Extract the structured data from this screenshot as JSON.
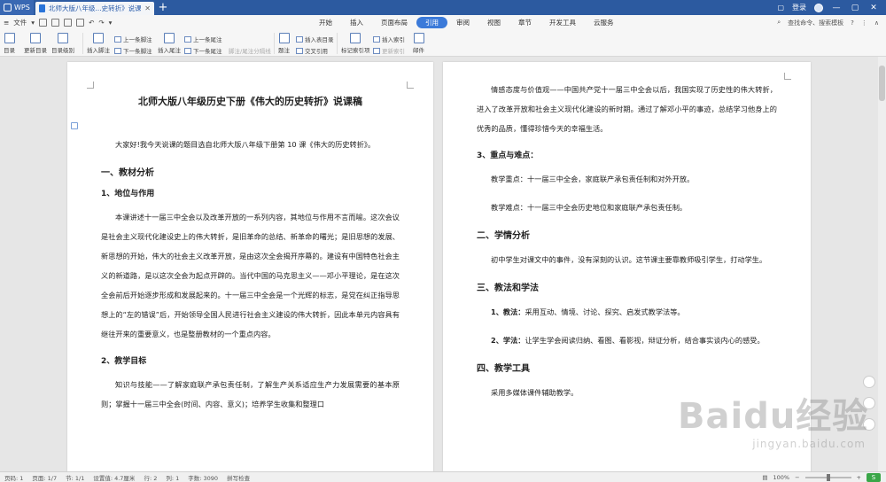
{
  "titlebar": {
    "app_tab": "WPS",
    "doc_tab": "北师大版八年级...史转折》说课稿",
    "login": "登录"
  },
  "menubar": {
    "file": "文件",
    "tabs": [
      "开始",
      "插入",
      "页面布局",
      "引用",
      "审阅",
      "视图",
      "章节",
      "开发工具",
      "云服务"
    ],
    "active_tab": "引用",
    "search": "查找命令、搜索模板"
  },
  "ribbon": {
    "toc": "目录",
    "update_toc": "更新目录",
    "toc_level": "目录级别",
    "insert_footnote": "插入脚注",
    "prev_footnote": "上一条脚注",
    "next_footnote": "下一条脚注",
    "insert_endnote": "插入尾注",
    "prev_endnote": "上一条尾注",
    "next_endnote": "下一条尾注",
    "note_separator": "脚注/尾注分隔线",
    "caption": "题注",
    "insert_table_of_figures": "插入表目录",
    "cross_reference": "交叉引用",
    "mark_index": "标记索引项",
    "insert_index": "插入索引",
    "update_index": "更新索引",
    "mail": "邮件"
  },
  "left_page": {
    "title": "北师大版八年级历史下册《伟大的历史转折》说课稿",
    "intro": "大家好!我今天说课的题目选自北师大版八年级下册第 10 课《伟大的历史转折》。",
    "h1_1": "一、教材分析",
    "h2_1": "1、地位与作用",
    "para_1": "本课讲述十一届三中全会以及改革开放的一系列内容，其地位与作用不言而喻。这次会议是社会主义现代化建设史上的伟大转折，是旧革命的总结、新革命的曙光；是旧思想的发展、新思想的开始，伟大的社会主义改革开放，是由这次全会揭开序幕的。建设有中国特色社会主义的新道路，是以这次全会为起点开辟的。当代中国的马克思主义——邓小平理论，是在这次全会前后开始逐步形成和发展起来的。十一届三中全会是一个光辉的标志，是党在纠正指导思想上的“左的错误”后，开始领导全国人民进行社会主义建设的伟大转折，因此本单元内容具有继往开来的重要意义，也是整册教材的一个重点内容。",
    "h2_2": "2、教学目标",
    "para_2": "知识与技能——了解家庭联产承包责任制，了解生产关系适应生产力发展需要的基本原则；掌握十一届三中全会(时间、内容、意义)；培养学生收集和整理口"
  },
  "right_page": {
    "para_1": "情感态度与价值观——中国共产党十一届三中全会以后，我国实现了历史性的伟大转折，进入了改革开放和社会主义现代化建设的新时期。通过了解邓小平的事迹，总结学习他身上的优秀的品质，懂得珍惜今天的幸福生活。",
    "h2_3": "3、重点与难点：",
    "key_point": "教学重点：十一届三中全会，家庭联产承包责任制和对外开放。",
    "difficult_point": "教学难点：十一届三中全会历史地位和家庭联产承包责任制。",
    "h1_2": "二、学情分析",
    "para_2": "初中学生对课文中的事件，没有深刻的认识。这节课主要靠教师吸引学生，打动学生。",
    "h1_3": "三、教法和学法",
    "teach_label": "1、教法：",
    "teach_text": "采用互动、情境、讨论、探究、启发式教学法等。",
    "learn_label": "2、学法：",
    "learn_text": "让学生学会阅读归纳、看图、看影视，辩证分析，结合事实谈内心的感受。",
    "h1_4": "四、教学工具",
    "tools": "采用多媒体课件辅助教学。"
  },
  "statusbar": {
    "page": "页码: 1",
    "pages": "页面: 1/7",
    "section": "节: 1/1",
    "setting": "设置值: 4.7厘米",
    "row": "行: 2",
    "col": "列: 1",
    "words": "字数: 3090",
    "spell": "拼写检查",
    "zoom": "100%",
    "zoom_level": 0.5
  },
  "watermark": {
    "main": "Baidu经验",
    "sub": "jingyan.baidu.com"
  }
}
